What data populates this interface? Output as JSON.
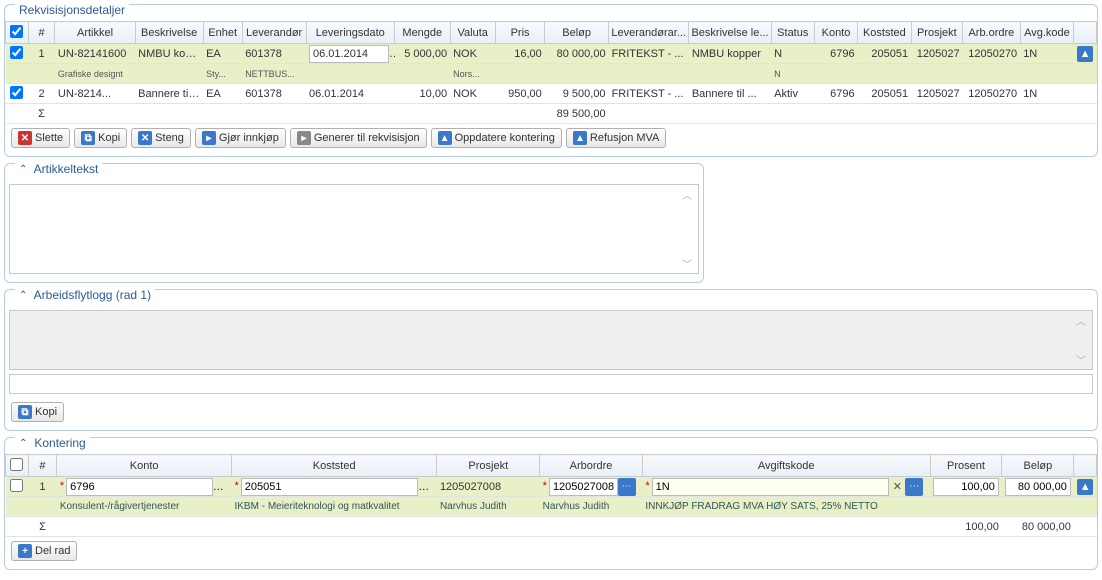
{
  "req": {
    "title": "Rekvisisjonsdetaljer",
    "headers": {
      "num": "#",
      "artikkel": "Artikkel",
      "beskrivelse": "Beskrivelse",
      "enhet": "Enhet",
      "leverandor": "Leverandør",
      "levdato": "Leveringsdato",
      "mengde": "Mengde",
      "valuta": "Valuta",
      "pris": "Pris",
      "belop": "Beløp",
      "levar": "Leverandørar...",
      "beskle": "Beskrivelse le...",
      "status": "Status",
      "konto": "Konto",
      "koststed": "Koststed",
      "prosjekt": "Prosjekt",
      "arbordre": "Arb.ordre",
      "avgkode": "Avg.kode"
    },
    "row1": {
      "num": "1",
      "artikkel": "UN-82141600",
      "artikkel_sub": "Grafiske designt",
      "beskrivelse": "NMBU kop...",
      "enhet": "EA",
      "enhet_sub": "Sty...",
      "leverandor": "601378",
      "leverandor_sub": "NETTBUS...",
      "levdato": "06.01.2014",
      "levdato_sub": "Nors...",
      "mengde": "5 000,00",
      "valuta": "NOK",
      "pris": "16,00",
      "belop": "80 000,00",
      "levar": "FRITEKST - ...",
      "beskle": "NMBU kopper",
      "status": "N",
      "status_sub": "N",
      "konto": "6796",
      "koststed": "205051",
      "prosjekt": "1205027",
      "arbordre": "12050270",
      "avgkode": "1N"
    },
    "row2": {
      "num": "2",
      "artikkel": "UN-8214...",
      "beskrivelse": "Bannere til ...",
      "enhet": "EA",
      "leverandor": "601378",
      "levdato": "06.01.2014",
      "mengde": "10,00",
      "valuta": "NOK",
      "pris": "950,00",
      "belop": "9 500,00",
      "levar": "FRITEKST - ...",
      "beskle": "Bannere til ...",
      "status": "Aktiv",
      "konto": "6796",
      "koststed": "205051",
      "prosjekt": "1205027",
      "arbordre": "12050270",
      "avgkode": "1N"
    },
    "sum": {
      "sigma": "Σ",
      "belop": "89 500,00"
    },
    "buttons": {
      "slette": "Slette",
      "kopi": "Kopi",
      "steng": "Steng",
      "innkjop": "Gjør innkjøp",
      "generer": "Generer til rekvisisjon",
      "oppdater": "Oppdatere kontering",
      "refusjon": "Refusjon MVA"
    }
  },
  "artikkeltekst": {
    "title": "Artikkeltekst"
  },
  "arbeidsflyt": {
    "title": "Arbeidsflytlogg (rad 1)",
    "kopi": "Kopi"
  },
  "kontering": {
    "title": "Kontering",
    "headers": {
      "num": "#",
      "konto": "Konto",
      "koststed": "Koststed",
      "prosjekt": "Prosjekt",
      "arbordre": "Arbordre",
      "avgiftskode": "Avgiftskode",
      "prosent": "Prosent",
      "belop": "Beløp"
    },
    "row": {
      "num": "1",
      "konto": "6796",
      "konto_sub": "Konsulent-/rågivertjenester",
      "koststed": "205051",
      "koststed_sub": "IKBM - Meieriteknologi og matkvalitet",
      "prosjekt": "1205027008",
      "prosjekt_sub": "Narvhus Judith",
      "arbordre": "1205027008",
      "arbordre_sub": "Narvhus Judith",
      "avgiftskode": "1N",
      "avgiftskode_sub": "INNKJØP FRADRAG MVA HØY SATS, 25% NETTO",
      "prosent": "100,00",
      "belop": "80 000,00"
    },
    "sum": {
      "sigma": "Σ",
      "prosent": "100,00",
      "belop": "80 000,00"
    },
    "delrad": "Del rad"
  }
}
